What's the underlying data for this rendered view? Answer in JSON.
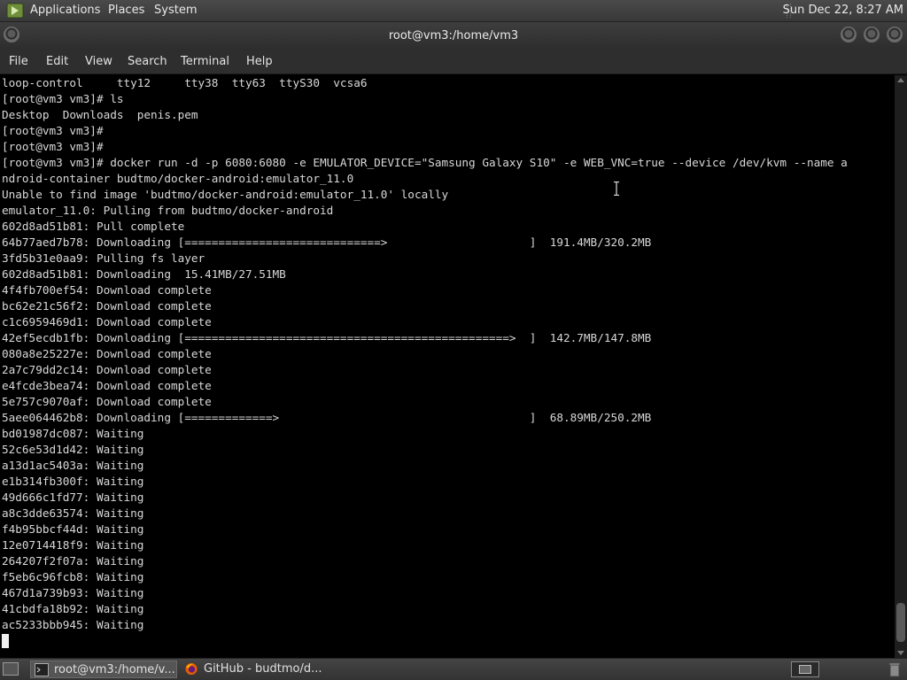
{
  "top_panel": {
    "menus": [
      "Applications",
      "Places",
      "System"
    ],
    "clock": "Sun Dec 22,  8:27 AM"
  },
  "window": {
    "title": "root@vm3:/home/vm3"
  },
  "menubar": {
    "items": [
      "File",
      "Edit",
      "View",
      "Search",
      "Terminal",
      "Help"
    ]
  },
  "terminal": {
    "lines": [
      "loop-control     tty12     tty38  tty63  ttyS30  vcsa6",
      "[root@vm3 vm3]# ls",
      "Desktop  Downloads  penis.pem",
      "[root@vm3 vm3]#",
      "[root@vm3 vm3]#",
      "[root@vm3 vm3]# docker run -d -p 6080:6080 -e EMULATOR_DEVICE=\"Samsung Galaxy S10\" -e WEB_VNC=true --device /dev/kvm --name a",
      "ndroid-container budtmo/docker-android:emulator_11.0",
      "Unable to find image 'budtmo/docker-android:emulator_11.0' locally",
      "emulator_11.0: Pulling from budtmo/docker-android",
      "602d8ad51b81: Pull complete",
      "64b77aed7b78: Downloading [=============================>                     ]  191.4MB/320.2MB",
      "3fd5b31e0aa9: Pulling fs layer",
      "602d8ad51b81: Downloading  15.41MB/27.51MB",
      "4f4fb700ef54: Download complete",
      "bc62e21c56f2: Download complete",
      "c1c6959469d1: Download complete",
      "42ef5ecdb1fb: Downloading [================================================>  ]  142.7MB/147.8MB",
      "080a8e25227e: Download complete",
      "2a7c79dd2c14: Download complete",
      "e4fcde3bea74: Download complete",
      "5e757c9070af: Download complete",
      "5aee064462b8: Downloading [=============>                                     ]  68.89MB/250.2MB",
      "bd01987dc087: Waiting",
      "52c6e53d1d42: Waiting",
      "a13d1ac5403a: Waiting",
      "e1b314fb300f: Waiting",
      "49d666c1fd77: Waiting",
      "a8c3dde63574: Waiting",
      "f4b95bbcf44d: Waiting",
      "12e0714418f9: Waiting",
      "264207f2f07a: Waiting",
      "f5eb6c96fcb8: Waiting",
      "467d1a739b93: Waiting",
      "41cbdfa18b92: Waiting",
      "ac5233bbb945: Waiting"
    ]
  },
  "taskbar": {
    "tasks": [
      {
        "label": "root@vm3:/home/v...",
        "icon": "terminal-icon",
        "active": true
      },
      {
        "label": "GitHub - budtmo/d...",
        "icon": "firefox-icon",
        "active": false
      }
    ]
  },
  "colors": {
    "terminal_bg": "#000000",
    "terminal_fg": "#d8d8d8",
    "panel_bg": "#3a3a3a"
  }
}
